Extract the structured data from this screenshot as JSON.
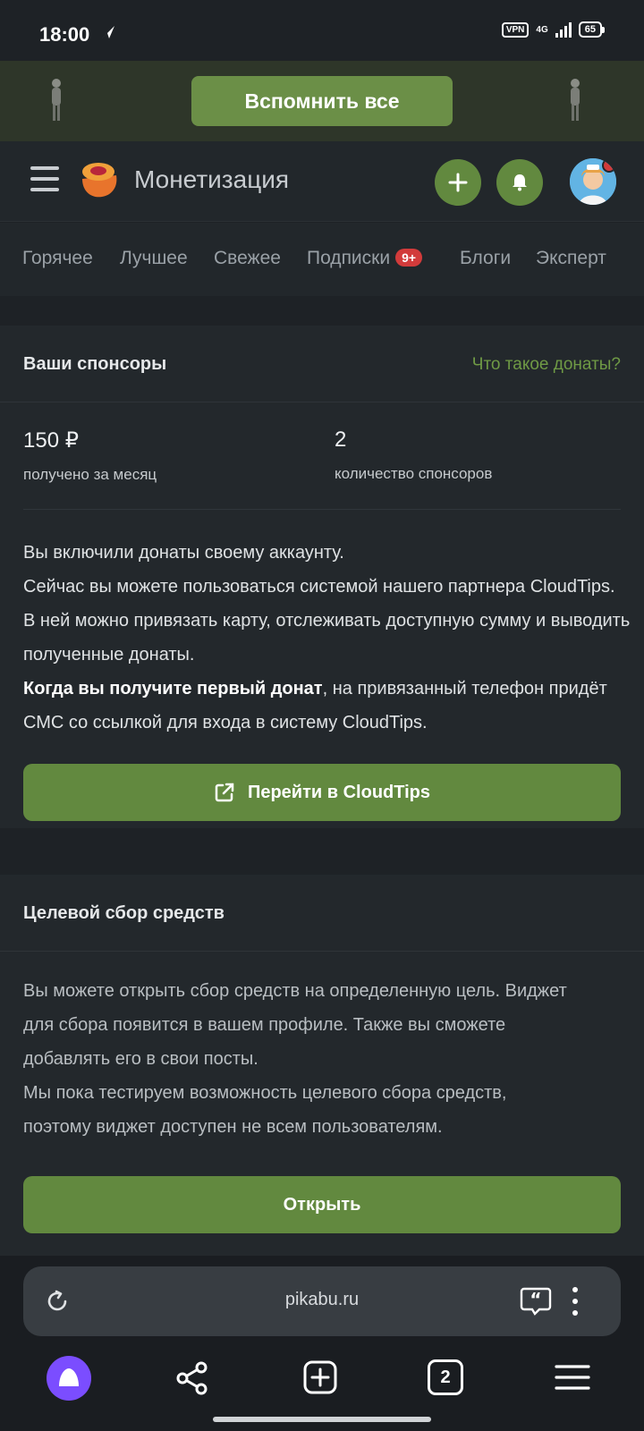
{
  "status_bar": {
    "time": "18:00",
    "vpn": "VPN",
    "network": "4G",
    "battery": "65"
  },
  "banner": {
    "button_label": "Вспомнить все"
  },
  "header": {
    "title": "Монетизация"
  },
  "tabs": [
    {
      "label": "Горячее"
    },
    {
      "label": "Лучшее"
    },
    {
      "label": "Свежее"
    },
    {
      "label": "Подписки",
      "badge": "9+"
    },
    {
      "label": "Блоги"
    },
    {
      "label": "Эксперт"
    }
  ],
  "sponsors": {
    "title": "Ваши спонсоры",
    "link": "Что такое донаты?",
    "stats": [
      {
        "value": "150 ₽",
        "label": "получено за месяц"
      },
      {
        "value": "2",
        "label": "количество спонсоров"
      }
    ],
    "line1": "Вы включили донаты своему аккаунту.",
    "line2": "Сейчас вы можете пользоваться системой нашего партнера CloudTips. В ней можно привязать карту, отслеживать доступную сумму и выводить полученные донаты.",
    "bold": "Когда вы получите первый донат",
    "line3": ", на привязанный телефон придёт СМС со ссылкой для входа в систему CloudTips.",
    "button_label": "Перейти в CloudTips"
  },
  "fundraising": {
    "title": "Целевой сбор средств",
    "text1": "Вы можете открыть сбор средств на определенную цель. Виджет для сбора появится в вашем профиле. Также вы сможете добавлять его в свои посты.",
    "text2": "Мы пока тестируем возможность целевого сбора средств, поэтому виджет доступен не всем пользователям.",
    "button_label": "Открыть"
  },
  "browser": {
    "url": "pikabu.ru",
    "tab_count": "2"
  },
  "colors": {
    "accent_green": "#62893f",
    "link_green": "#6f9a45",
    "badge_red": "#d23b3b",
    "card_bg": "#23282c"
  }
}
